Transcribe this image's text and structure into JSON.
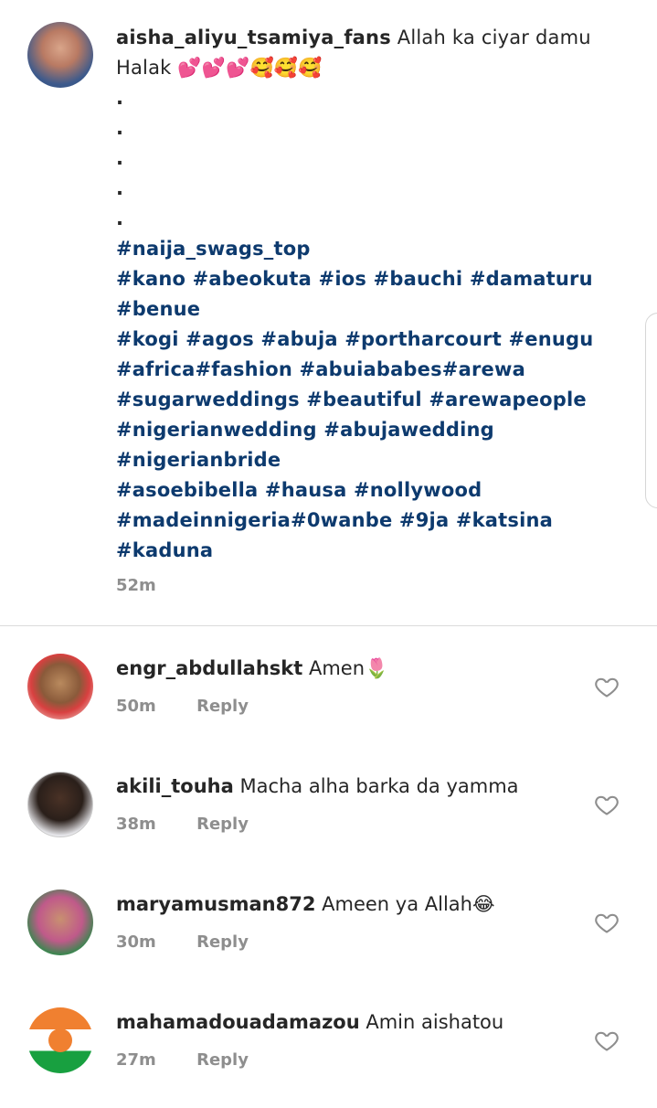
{
  "post": {
    "username": "aisha_aliyu_tsamiya_fans",
    "text": "Allah ka ciyar damu Halak 💕💕💕🥰🥰🥰",
    "dots": [
      ".",
      ".",
      ".",
      ".",
      "."
    ],
    "hashtag_lines": [
      "#naija_swags_top",
      "#kano #abeokuta #ios #bauchi #damaturu",
      "#benue",
      "#kogi #agos #abuja #portharcourt #enugu",
      "#africa#fashion #abuiababes#arewa",
      "#sugarweddings #beautiful #arewapeople",
      "#nigerianwedding #abujawedding",
      "#nigerianbride",
      "#asoebibella #hausa #nollywood",
      "#madeinnigeria#0wanbe #9ja #katsina",
      "#kaduna"
    ],
    "time": "52m"
  },
  "comments": [
    {
      "username": "engr_abdullahskt",
      "text": "Amen🌷",
      "time": "50m",
      "reply_label": "Reply",
      "avatar_icon": "profile-photo"
    },
    {
      "username": "akili_touha",
      "text": "Macha alha barka da yamma",
      "time": "38m",
      "reply_label": "Reply",
      "avatar_icon": "profile-photo"
    },
    {
      "username": "maryamusman872",
      "text": "Ameen ya Allah😂",
      "time": "30m",
      "reply_label": "Reply",
      "avatar_icon": "profile-photo"
    },
    {
      "username": "mahamadouadamazou",
      "text": "Amin aishatou",
      "time": "27m",
      "reply_label": "Reply",
      "avatar_icon": "niger-flag"
    }
  ],
  "colors": {
    "hashtag": "#0d3a6e",
    "text": "#262626",
    "muted": "#8e8e8e",
    "divider": "#dbdbdb"
  },
  "icons": {
    "like": "heart-outline-icon"
  }
}
